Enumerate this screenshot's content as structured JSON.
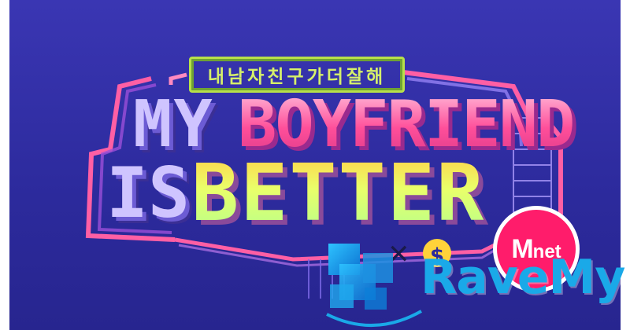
{
  "poster": {
    "korean_title": "내남자친구가더잘해",
    "title_line1_part1": "MY",
    "title_line1_part2": "BOYFRIEND",
    "title_line2_part1": "IS",
    "title_line2_part2": "BETTER",
    "symbols": {
      "times": "✕",
      "dollar": "$"
    }
  },
  "badge": {
    "brand_m": "M",
    "brand_net": "net"
  },
  "watermark": {
    "text": "RaveMy",
    "icon": "ravemy-logo-icon"
  },
  "colors": {
    "background": "#2f2ca2",
    "pink": "#ff4f9a",
    "yellow": "#e9ff6a",
    "lavender": "#cfc4ff",
    "mnet_red": "#ff1c6b",
    "watermark_blue": "#1aa9e8"
  }
}
